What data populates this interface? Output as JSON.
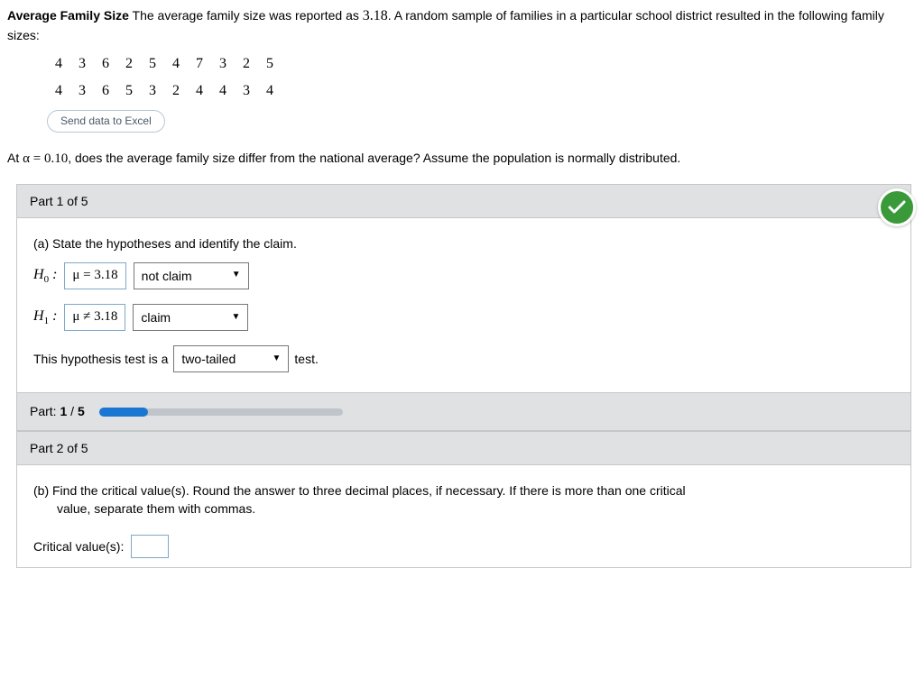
{
  "intro": {
    "title": "Average Family Size",
    "text1": " The average family size was reported as ",
    "value": "3.18",
    "text2": ". A random sample of families in a particular school district resulted in the following family sizes:"
  },
  "data_rows": [
    [
      "4",
      "3",
      "6",
      "2",
      "5",
      "4",
      "7",
      "3",
      "2",
      "5"
    ],
    [
      "4",
      "3",
      "6",
      "5",
      "3",
      "2",
      "4",
      "4",
      "3",
      "4"
    ]
  ],
  "send_button": "Send data to Excel",
  "question": {
    "prefix": "At ",
    "alpha_expr": "α = 0.10",
    "suffix": ", does the average family size differ from the national average? Assume the population is normally distributed."
  },
  "part1": {
    "header": "Part 1 of 5",
    "prompt": "(a) State the hypotheses and identify the claim.",
    "h0_label": "H",
    "h0_sub": "0",
    "h0_box": "μ = 3.18",
    "h0_select": "not claim",
    "h1_label": "H",
    "h1_sub": "1",
    "h1_box": "μ ≠ 3.18",
    "h1_select": "claim",
    "sentence_pre": "This hypothesis test is a",
    "tail_select": "two-tailed",
    "sentence_post": "test."
  },
  "progress": {
    "label_pre": "Part: ",
    "current": "1",
    "sep": " / ",
    "total": "5",
    "percent": 20
  },
  "part2": {
    "header": "Part 2 of 5",
    "prompt_a": "(b) Find the critical value(s). Round the answer to three decimal places, if necessary. If there is more than one critical",
    "prompt_b": "value, separate them with commas.",
    "cv_label": "Critical value(s):"
  }
}
